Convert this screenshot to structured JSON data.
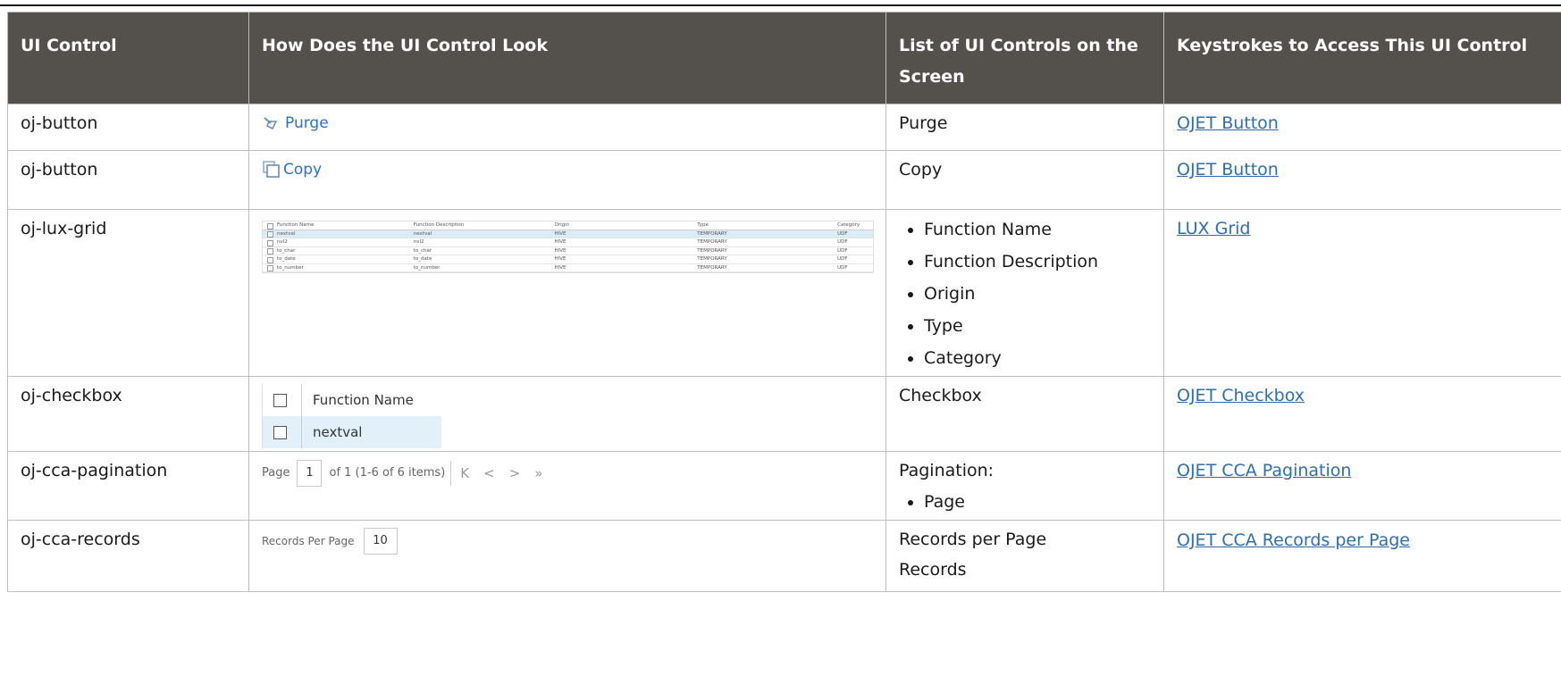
{
  "headers": {
    "col1": "UI Control",
    "col2": "How Does the UI Control Look",
    "col3": "List of UI Controls on the Screen",
    "col4": "Keystrokes to Access This UI Control"
  },
  "rows": [
    {
      "control": "oj-button",
      "list": "Purge",
      "link": "OJET Button",
      "preview": {
        "label": "Purge",
        "icon": "purge-icon"
      }
    },
    {
      "control": "oj-button",
      "list": "Copy",
      "link": "OJET Button",
      "preview": {
        "label": "Copy",
        "icon": "copy-icon"
      }
    },
    {
      "control": "oj-lux-grid",
      "list_items": [
        "Function Name",
        "Function Description",
        "Origin",
        "Type",
        "Category"
      ],
      "link": "LUX Grid",
      "preview": {
        "columns": [
          "Function Name",
          "Function Description",
          "Origin",
          "Type",
          "Category"
        ],
        "rows": [
          [
            "nextval",
            "nextval",
            "HIVE",
            "TEMPORARY",
            "UDF"
          ],
          [
            "nvl2",
            "nvl2",
            "HIVE",
            "TEMPORARY",
            "UDF"
          ],
          [
            "to_char",
            "to_char",
            "HIVE",
            "TEMPORARY",
            "UDF"
          ],
          [
            "to_date",
            "to_date",
            "HIVE",
            "TEMPORARY",
            "UDF"
          ],
          [
            "to_number",
            "to_number",
            "HIVE",
            "TEMPORARY",
            "UDF"
          ]
        ]
      }
    },
    {
      "control": "oj-checkbox",
      "list": "Checkbox",
      "link": "OJET Checkbox",
      "preview": {
        "header": "Function Name",
        "row": "nextval"
      }
    },
    {
      "control": "oj-cca-pagination",
      "list": "Pagination:",
      "list_items": [
        "Page"
      ],
      "link": "OJET CCA Pagination",
      "preview": {
        "page_label": "Page",
        "page_value": "1",
        "of_text": "of 1 (1-6 of 6 items)",
        "first": "K",
        "prev": "<",
        "next": ">",
        "last": "»"
      }
    },
    {
      "control": "oj-cca-records",
      "list": "Records per Page",
      "list2": "Records",
      "link": "OJET CCA Records per Page",
      "preview": {
        "label": "Records Per Page",
        "value": "10"
      }
    }
  ],
  "colors": {
    "header_bg": "#54504c",
    "link": "#2f6eae",
    "button_blue": "#2a72c9",
    "selected_row": "#dcecf7"
  }
}
